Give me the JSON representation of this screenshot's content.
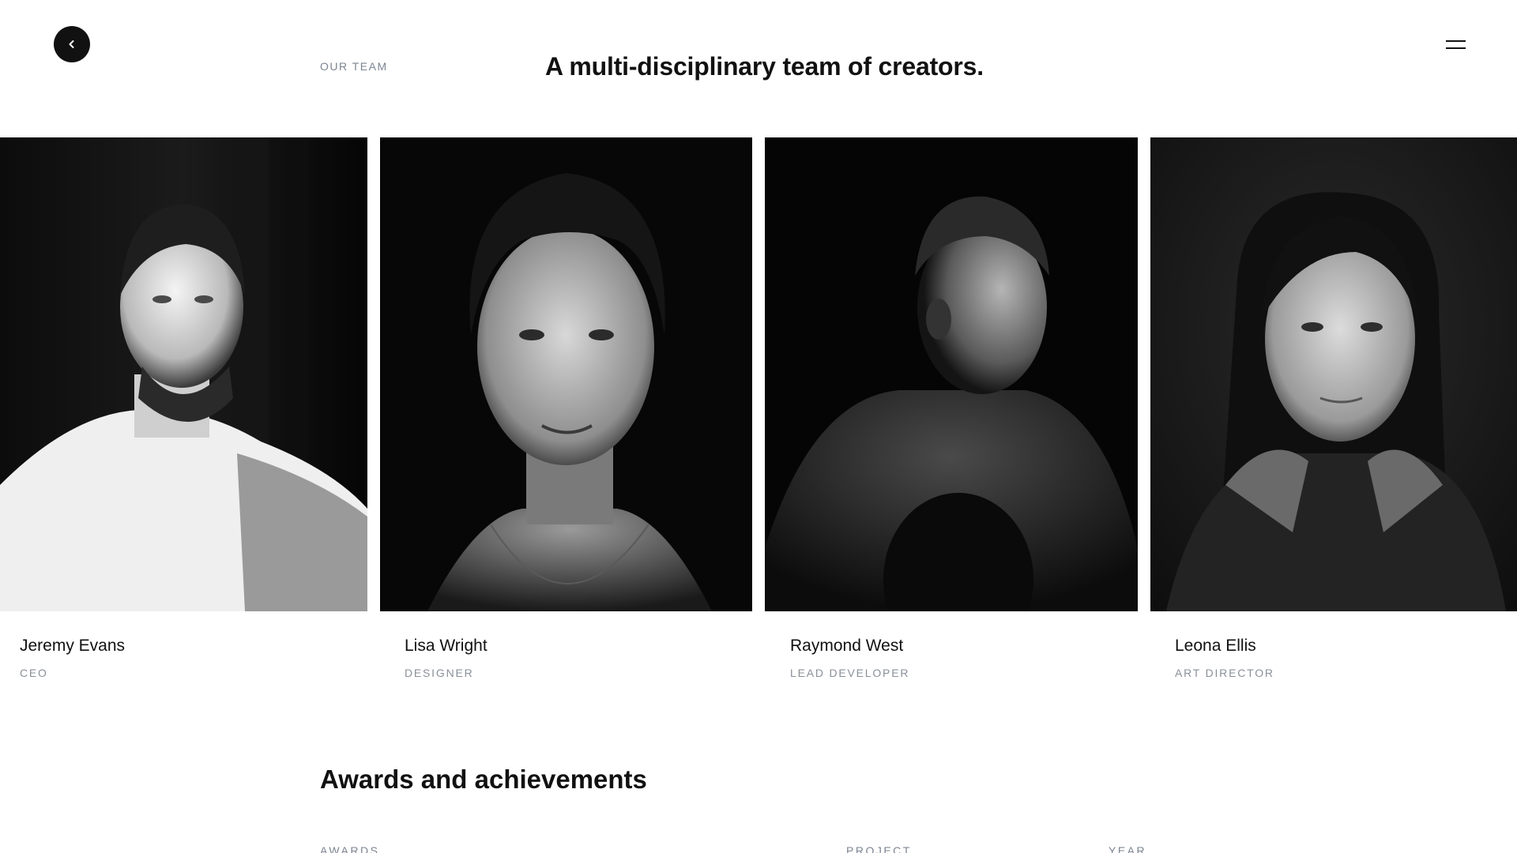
{
  "header": {
    "eyebrow": "OUR TEAM",
    "headline": "A multi-disciplinary team of creators."
  },
  "icons": {
    "back": "chevron-left-icon",
    "menu": "hamburger-menu-icon"
  },
  "team": [
    {
      "name": "Jeremy Evans",
      "role": "CEO"
    },
    {
      "name": "Lisa Wright",
      "role": "DESIGNER"
    },
    {
      "name": "Raymond West",
      "role": "LEAD DEVELOPER"
    },
    {
      "name": "Leona Ellis",
      "role": "ART DIRECTOR"
    }
  ],
  "awards": {
    "title": "Awards and achievements",
    "columns": [
      "AWARDS",
      "PROJECT",
      "YEAR"
    ]
  },
  "colors": {
    "text": "#111111",
    "muted": "#7d8592",
    "background": "#ffffff"
  }
}
